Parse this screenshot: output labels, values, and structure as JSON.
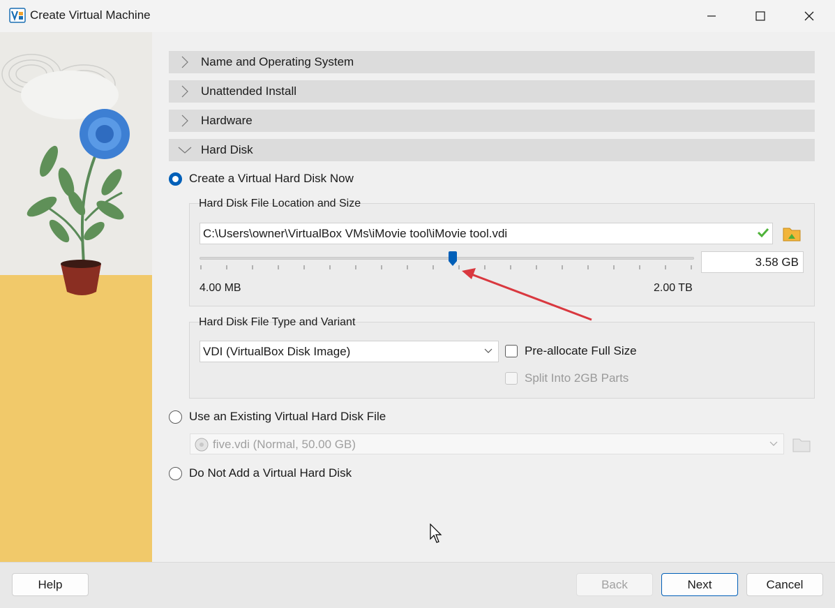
{
  "window": {
    "title": "Create Virtual Machine"
  },
  "sections": [
    {
      "label": "Name and Operating System",
      "expanded": false
    },
    {
      "label": "Unattended Install",
      "expanded": false
    },
    {
      "label": "Hardware",
      "expanded": false
    },
    {
      "label": "Hard Disk",
      "expanded": true
    }
  ],
  "hard_disk": {
    "option_create": "Create a Virtual Hard Disk Now",
    "location_group_title": "Hard Disk File Location and Size",
    "file_path": "C:\\Users\\owner\\VirtualBox VMs\\iMovie tool\\iMovie tool.vdi",
    "size_value": "3.58 GB",
    "size_slider_fraction": 0.51,
    "min_label": "4.00 MB",
    "max_label": "2.00 TB",
    "type_group_title": "Hard Disk File Type and Variant",
    "disk_type_selected": "VDI (VirtualBox Disk Image)",
    "preallocate_label": "Pre-allocate Full Size",
    "split_label": "Split Into 2GB Parts",
    "option_existing": "Use an Existing Virtual Hard Disk File",
    "existing_disk": "five.vdi (Normal, 50.00 GB)",
    "option_none": "Do Not Add a Virtual Hard Disk"
  },
  "footer": {
    "help": "Help",
    "back": "Back",
    "next": "Next",
    "cancel": "Cancel"
  },
  "colors": {
    "accent": "#005fb8",
    "annotation_arrow": "#d9383f"
  }
}
